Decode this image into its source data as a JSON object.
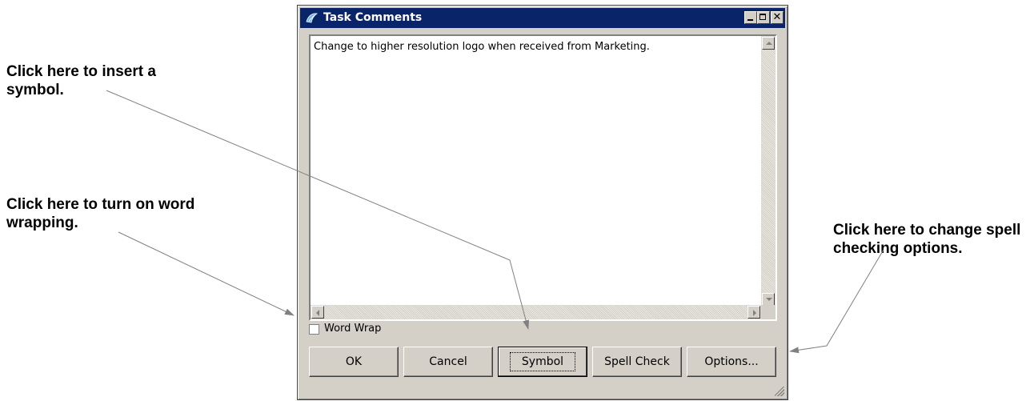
{
  "callouts": {
    "symbol": "Click here to insert a\nsymbol.",
    "word_wrap": "Click here to turn on word\nwrapping.",
    "options": "Click here to change spell\nchecking options."
  },
  "window": {
    "title": "Task Comments",
    "icon": "task-comments-icon",
    "minimize_icon": "minimize-icon",
    "maximize_icon": "maximize-icon",
    "close_glyph": "✕"
  },
  "comment": {
    "text": "Change to higher resolution logo when received from Marketing."
  },
  "word_wrap": {
    "label": "Word Wrap",
    "checked": false
  },
  "buttons": {
    "ok": "OK",
    "cancel": "Cancel",
    "symbol": "Symbol",
    "spell_check": "Spell Check",
    "options": "Options..."
  },
  "colors": {
    "titlebar": "#0a246a",
    "dialog_face": "#d4d0c8"
  }
}
